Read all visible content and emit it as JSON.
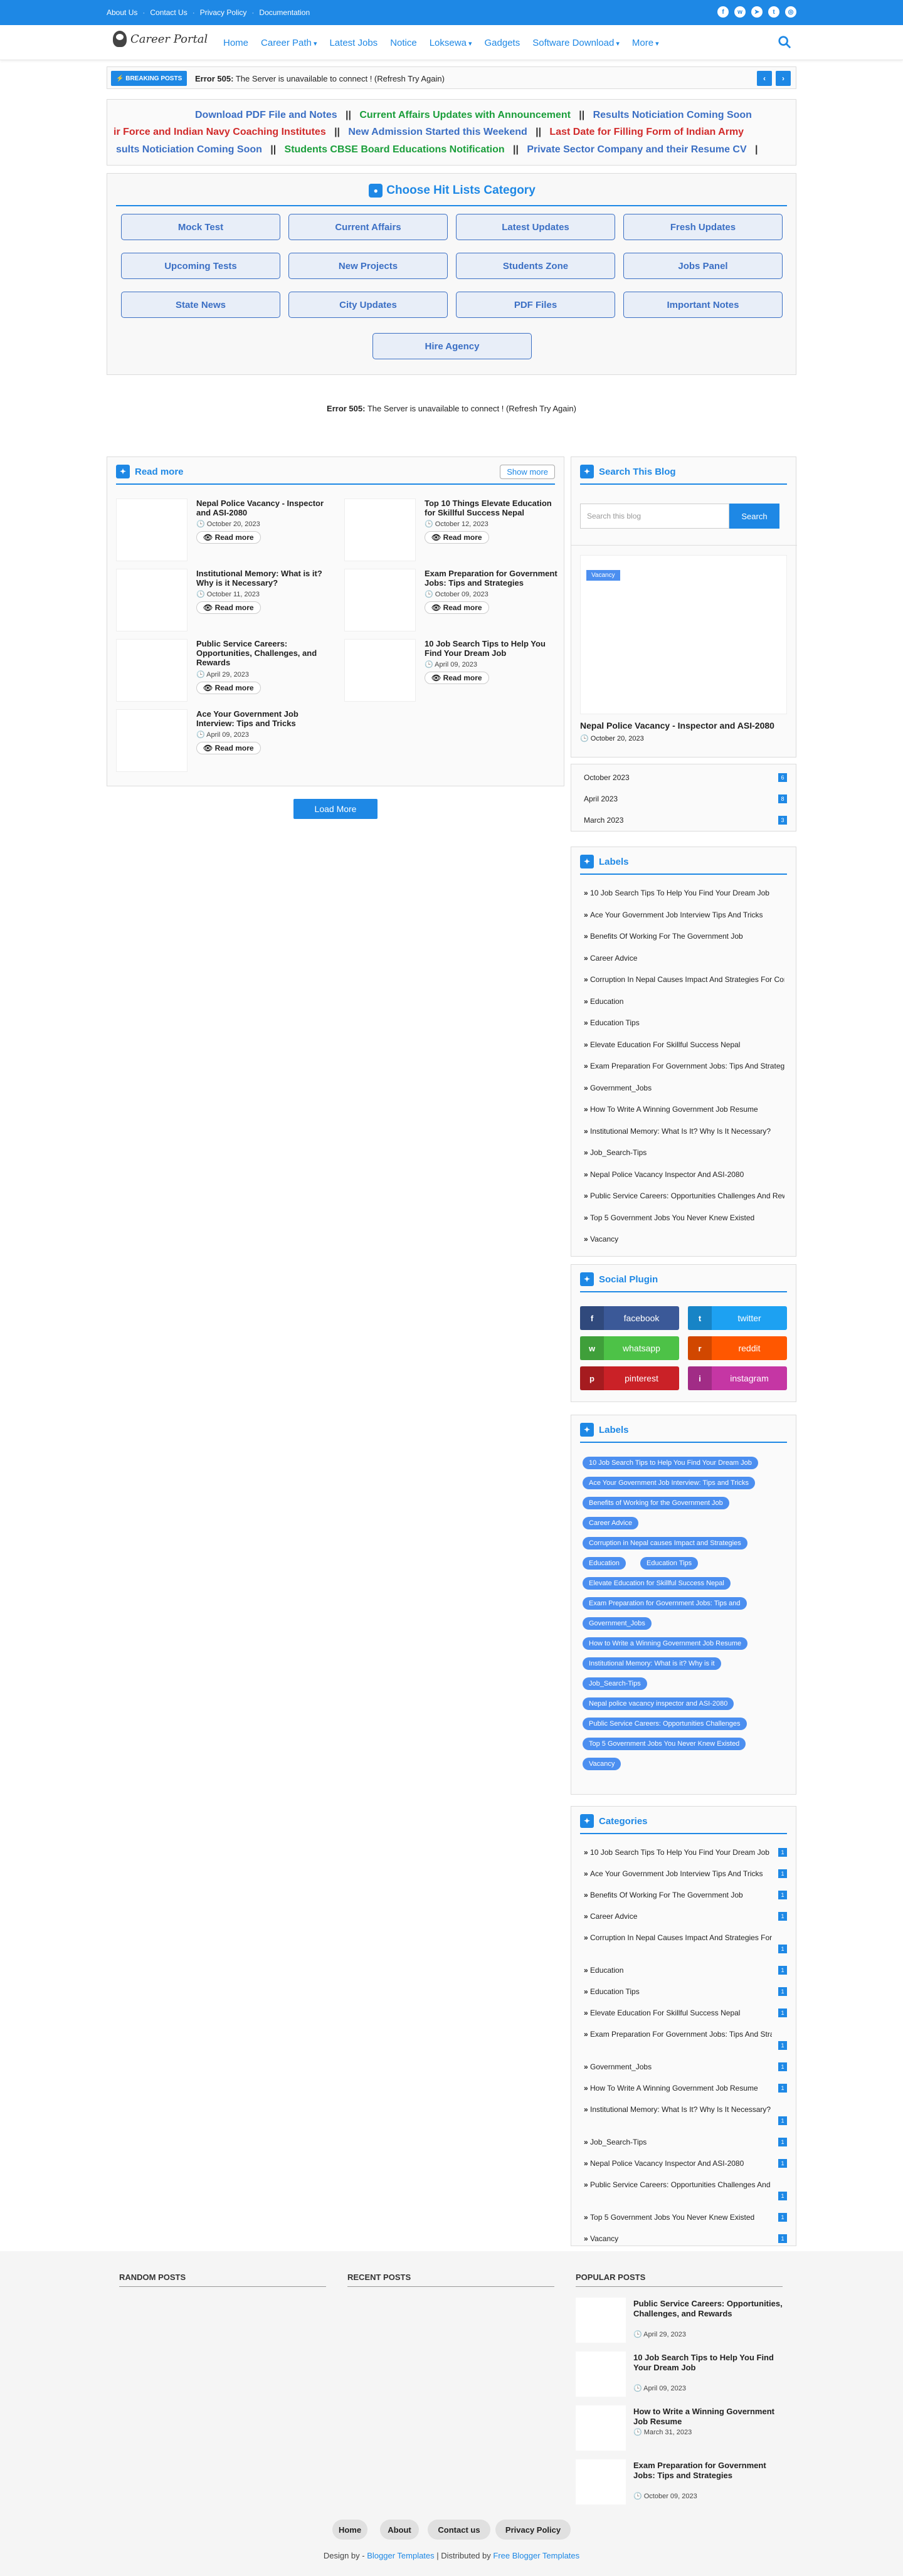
{
  "topbar": {
    "links": [
      "About Us",
      "Contact Us",
      "Privacy Policy",
      "Documentation"
    ],
    "social": [
      "facebook-icon",
      "whatsapp-icon",
      "telegram-icon",
      "twitter-icon",
      "instagram-icon"
    ]
  },
  "header": {
    "logo_text": "Career Portal",
    "nav": [
      "Home",
      "Career Path",
      "Latest Jobs",
      "Notice",
      "Loksewa",
      "Gadgets",
      "Software Download",
      "More"
    ]
  },
  "breaking": {
    "label": "BREAKING POSTS",
    "error_code": "Error 505:",
    "message": "The Server is unavailable to connect ! (Refresh Try Again)"
  },
  "marquee": {
    "line1": [
      {
        "text": "Download PDF File and Notes",
        "color": "blue"
      },
      {
        "text": "||",
        "color": "dark"
      },
      {
        "text": "Current Affairs Updates with Announcement",
        "color": "green"
      },
      {
        "text": "||",
        "color": "dark"
      },
      {
        "text": "Results Noticiation Coming Soon",
        "color": "blue"
      }
    ],
    "line2": [
      {
        "text": "ir Force and Indian Navy Coaching Institutes",
        "color": "red"
      },
      {
        "text": "||",
        "color": "dark"
      },
      {
        "text": "New Admission Started this Weekend",
        "color": "blue"
      },
      {
        "text": "||",
        "color": "dark"
      },
      {
        "text": "Last Date for Filling Form of Indian Army",
        "color": "red"
      }
    ],
    "line3": [
      {
        "text": "sults Noticiation Coming Soon",
        "color": "blue"
      },
      {
        "text": "||",
        "color": "dark"
      },
      {
        "text": "Students CBSE Board Educations Notification",
        "color": "green"
      },
      {
        "text": "||",
        "color": "dark"
      },
      {
        "text": "Private Sector Company and their Resume CV",
        "color": "blue"
      },
      {
        "text": "|",
        "color": "dark"
      }
    ]
  },
  "categories_box": {
    "title": "Choose Hit Lists Category",
    "buttons": [
      "Mock Test",
      "Current Affairs",
      "Latest Updates",
      "Fresh Updates",
      "Upcoming Tests",
      "New Projects",
      "Students Zone",
      "Jobs Panel",
      "State News",
      "City Updates",
      "PDF Files",
      "Important Notes",
      "Hire Agency"
    ]
  },
  "error_line": {
    "code": "Error 505:",
    "message": "The Server is unavailable to connect ! (Refresh Try Again)"
  },
  "read_more": {
    "title": "Read more",
    "show_more": "Show more",
    "read_label": "Read more",
    "posts": [
      {
        "title": "Nepal Police Vacancy - Inspector and ASI-2080",
        "date": "October 20, 2023"
      },
      {
        "title": "Top 10 Things Elevate Education for Skillful Success Nepal",
        "date": "October 12, 2023"
      },
      {
        "title": "Institutional Memory: What is it? Why is it Necessary?",
        "date": "October 11, 2023"
      },
      {
        "title": "Exam Preparation for Government Jobs: Tips and Strategies",
        "date": "October 09, 2023"
      },
      {
        "title": "Public Service Careers: Opportunities, Challenges, and Rewards",
        "date": "April 29, 2023"
      },
      {
        "title": "10 Job Search Tips to Help You Find Your Dream Job",
        "date": "April 09, 2023"
      },
      {
        "title": "Ace Your Government Job Interview: Tips and Tricks",
        "date": "April 09, 2023"
      }
    ],
    "load_more": "Load More"
  },
  "sidebar": {
    "search": {
      "title": "Search This Blog",
      "placeholder": "Search this blog",
      "button": "Search"
    },
    "featured": {
      "badge": "Vacancy",
      "title": "Nepal Police Vacancy - Inspector and ASI-2080",
      "date": "October 20, 2023"
    },
    "archive": [
      {
        "label": "October 2023",
        "count": "6"
      },
      {
        "label": "April 2023",
        "count": "8"
      },
      {
        "label": "March 2023",
        "count": "3"
      }
    ],
    "labels_title": "Labels",
    "labels": [
      "10 Job Search Tips To Help You Find Your Dream Job",
      "Ace Your Government Job Interview Tips And Tricks",
      "Benefits Of Working For The Government Job",
      "Career Advice",
      "Corruption In Nepal Causes Impact And Strategies For Combating It",
      "Education",
      "Education Tips",
      "Elevate Education For Skillful Success Nepal",
      "Exam Preparation For Government Jobs: Tips And Strategies",
      "Government_Jobs",
      "How To Write A Winning Government Job Resume",
      "Institutional Memory: What Is It? Why Is It Necessary?",
      "Job_Search-Tips",
      "Nepal Police Vacancy Inspector And ASI-2080",
      "Public Service Careers: Opportunities Challenges And Rewards",
      "Top 5 Government Jobs You Never Knew Existed",
      "Vacancy"
    ],
    "social_title": "Social Plugin",
    "social": [
      {
        "name": "facebook",
        "icon": "f",
        "color": "#3b5998"
      },
      {
        "name": "twitter",
        "icon": "t",
        "color": "#1da1f2"
      },
      {
        "name": "whatsapp",
        "icon": "w",
        "color": "#4dc247"
      },
      {
        "name": "reddit",
        "icon": "r",
        "color": "#ff5700"
      },
      {
        "name": "pinterest",
        "icon": "p",
        "color": "#ca2127"
      },
      {
        "name": "instagram",
        "icon": "i",
        "color": "#c536a4"
      }
    ],
    "cloud_title": "Labels",
    "cloud": [
      "10 Job Search Tips to Help You Find Your Dream Job",
      "Ace Your Government Job Interview: Tips and Tricks",
      "Benefits of Working for the Government Job",
      "Career Advice",
      "Corruption in Nepal causes Impact and Strategies",
      "Education",
      "Education Tips",
      "Elevate Education for Skillful Success Nepal",
      "Exam Preparation for Government Jobs: Tips and",
      "Government_Jobs",
      "How to Write a Winning Government Job Resume",
      "Institutional Memory: What is it? Why is it",
      "Job_Search-Tips",
      "Nepal police vacancy inspector and ASI-2080",
      "Public Service Careers: Opportunities Challenges",
      "Top 5 Government Jobs You Never Knew Existed",
      "Vacancy"
    ],
    "categories_title": "Categories",
    "categories": [
      {
        "label": "10 Job Search Tips To Help You Find Your Dream Job",
        "count": "1"
      },
      {
        "label": "Ace Your Government Job Interview Tips And Tricks",
        "count": "1"
      },
      {
        "label": "Benefits Of Working For The Government Job",
        "count": "1"
      },
      {
        "label": "Career Advice",
        "count": "1"
      },
      {
        "label": "Corruption In Nepal Causes Impact And Strategies For Combating It",
        "count": "1"
      },
      {
        "label": "Education",
        "count": "1"
      },
      {
        "label": "Education Tips",
        "count": "1"
      },
      {
        "label": "Elevate Education For Skillful Success Nepal",
        "count": "1"
      },
      {
        "label": "Exam Preparation For Government Jobs: Tips And Strategies",
        "count": "1"
      },
      {
        "label": "Government_Jobs",
        "count": "1"
      },
      {
        "label": "How To Write A Winning Government Job Resume",
        "count": "1"
      },
      {
        "label": "Institutional Memory: What Is It? Why Is It Necessary?",
        "count": "1"
      },
      {
        "label": "Job_Search-Tips",
        "count": "1"
      },
      {
        "label": "Nepal Police Vacancy Inspector And ASI-2080",
        "count": "1"
      },
      {
        "label": "Public Service Careers: Opportunities Challenges And Rewards",
        "count": "1"
      },
      {
        "label": "Top 5 Government Jobs You Never Knew Existed",
        "count": "1"
      },
      {
        "label": "Vacancy",
        "count": "1"
      }
    ]
  },
  "footer": {
    "random_title": "RANDOM POSTS",
    "recent_title": "RECENT POSTS",
    "popular_title": "POPULAR POSTS",
    "popular": [
      {
        "title": "Public Service Careers: Opportunities, Challenges, and Rewards",
        "date": "April 29, 2023"
      },
      {
        "title": "10 Job Search Tips to Help You Find Your Dream Job",
        "date": "April 09, 2023"
      },
      {
        "title": "How to Write a Winning Government Job Resume",
        "date": "March 31, 2023"
      },
      {
        "title": "Exam Preparation for Government Jobs: Tips and Strategies",
        "date": "October 09, 2023"
      }
    ],
    "buttons": [
      "Home",
      "About",
      "Contact us",
      "Privacy Policy"
    ],
    "credit_prefix": "Design by -",
    "credit_design": "Blogger Templates",
    "credit_mid": "| Distributed by",
    "credit_dist": "Free Blogger Templates"
  }
}
